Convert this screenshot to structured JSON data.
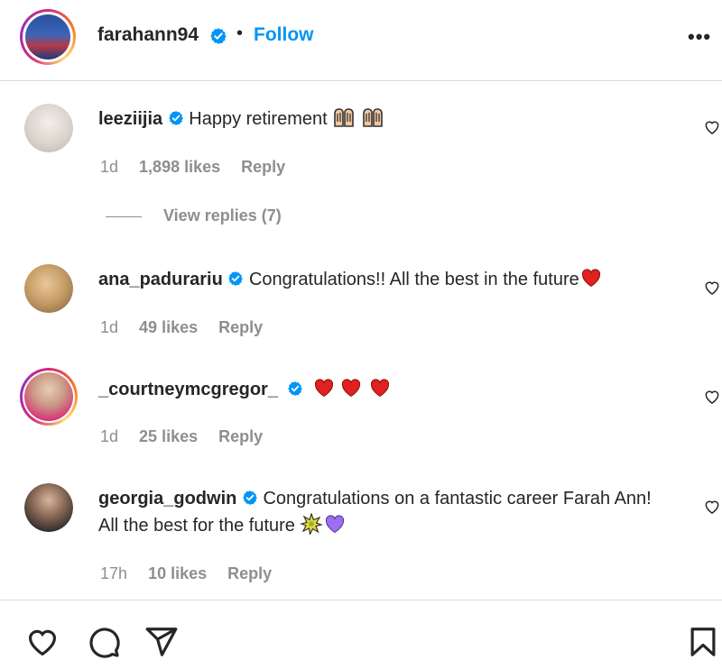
{
  "header": {
    "username": "farahann94",
    "separator": "•",
    "follow_label": "Follow",
    "more_label": "•••"
  },
  "comments": [
    {
      "username": "leeziijia",
      "text": "Happy retirement",
      "emojis": [
        "raising-hands",
        "raising-hands"
      ],
      "time": "1d",
      "likes": "1,898 likes",
      "reply_label": "Reply",
      "view_replies": "View replies (7)"
    },
    {
      "username": "ana_padurariu",
      "text": "Congratulations!! All the best in the future",
      "emojis": [
        "red-heart"
      ],
      "time": "1d",
      "likes": "49 likes",
      "reply_label": "Reply"
    },
    {
      "username": "_courtneymcgregor_",
      "text": "",
      "emojis": [
        "red-heart",
        "red-heart",
        "red-heart"
      ],
      "time": "1d",
      "likes": "25 likes",
      "reply_label": "Reply"
    },
    {
      "username": "georgia_godwin",
      "text": "Congratulations on a fantastic career Farah Ann! All the best for the future",
      "emojis": [
        "sparkle",
        "purple-heart"
      ],
      "time": "17h",
      "likes": "10 likes",
      "reply_label": "Reply"
    }
  ],
  "icons": {
    "verified": "verified-badge-icon",
    "like": "heart-icon",
    "comment": "comment-icon",
    "share": "share-icon",
    "save": "bookmark-icon"
  },
  "colors": {
    "accent": "#0095f6",
    "verified": "#0095f6",
    "muted": "#8e8e8e",
    "text": "#262626",
    "heart_red": "#e0211f",
    "purple_heart": "#9b6ff0"
  }
}
